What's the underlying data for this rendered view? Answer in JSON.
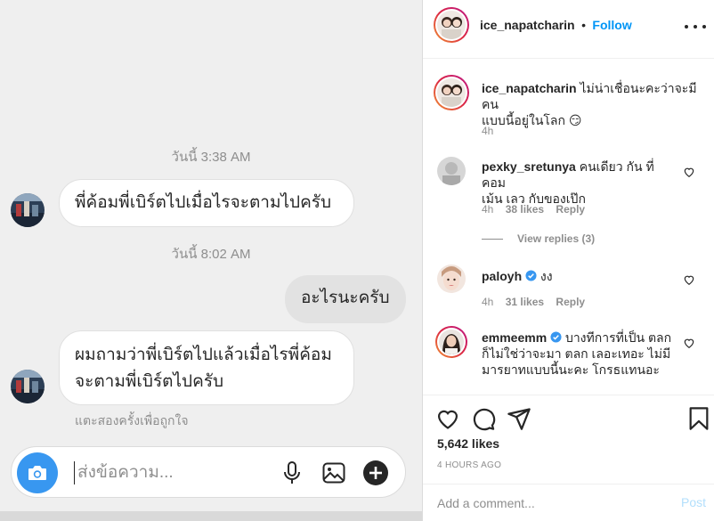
{
  "chat": {
    "timestamp_1": "วันนี้ 3:38 AM",
    "message_1": "พี่ค้อมพี่เบิร์ตไปเมื่อไรจะตามไปครับ",
    "timestamp_2": "วันนี้ 8:02 AM",
    "message_2": "อะไรนะครับ",
    "message_3_line_1": "ผมถามว่าพี่เบิร์ตไปแล้วเมื่อไรพี่ค้อม",
    "message_3_line_2": "จะตามพี่เบิร์ตไปครับ",
    "double_tap_hint": "แตะสองครั้งเพื่อถูกใจ",
    "input_placeholder": "ส่งข้อความ...",
    "icons": [
      "camera-icon",
      "microphone-icon",
      "image-icon",
      "plus-icon"
    ]
  },
  "post": {
    "author": "ice_napatcharin",
    "separator": "•",
    "follow_label": "Follow",
    "caption_line_1": "ไม่น่าเชื่อนะคะว่าจะมีคน",
    "caption_line_2": "แบบนี้อยู่ในโลก 😏",
    "caption_time": "4h",
    "comments": [
      {
        "user": "pexky_sretunya",
        "text_line_1": "คนเดียว กัน ที่ คอม",
        "text_line_2": "เม้น เลว กับของเป๊ก",
        "time": "4h",
        "likes": "38 likes",
        "reply": "Reply"
      },
      {
        "user": "paloyh",
        "text_line_1": "งง",
        "time": "4h",
        "likes": "31 likes",
        "reply": "Reply"
      },
      {
        "user": "emmeemm",
        "text_line_1": "บางทีการที่เป็น ตลก",
        "text_line_2": "ก็ไม่ใช่ว่าจะมา ตลก เลอะเทอะ ไม่มี",
        "text_line_3": "มารยาทแบบนี้นะคะ โกรธแทนอะ"
      }
    ],
    "view_replies": "View replies (3)",
    "likes_count": "5,642 likes",
    "posted_time": "4 HOURS AGO",
    "add_comment_placeholder": "Add a comment...",
    "post_button": "Post",
    "colors": {
      "link_blue": "#0095f6",
      "verified_blue": "#3897f0",
      "meta_gray": "#8e8e8e"
    },
    "icons": [
      "heart-icon",
      "comment-icon",
      "share-icon",
      "bookmark-icon",
      "more-icon",
      "verified-icon"
    ]
  }
}
